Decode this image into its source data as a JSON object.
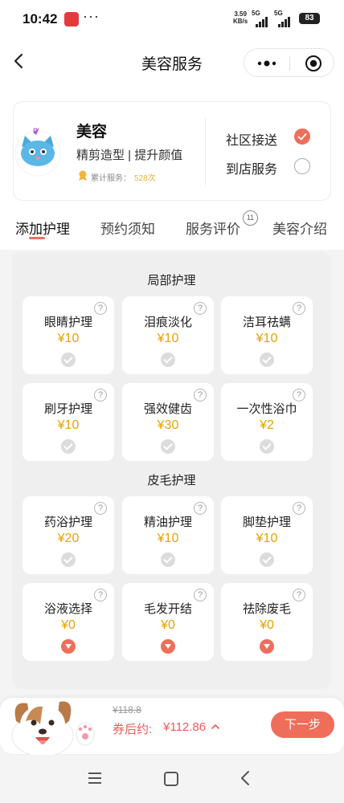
{
  "status_bar": {
    "time": "10:42",
    "dots": "···",
    "net_speed_value": "3.59",
    "net_speed_unit": "KB/s",
    "network_1": "5G",
    "network_2": "5G",
    "battery": "83"
  },
  "nav": {
    "title": "美容服务"
  },
  "service": {
    "name": "美容",
    "description": "精剪造型 | 提升颜值",
    "count_label": "累计服务：",
    "count_value": "528次",
    "options": [
      {
        "label": "社区接送",
        "selected": true
      },
      {
        "label": "到店服务",
        "selected": false
      }
    ]
  },
  "tabs": [
    {
      "label": "添加护理",
      "active": true
    },
    {
      "label": "预约须知",
      "active": false
    },
    {
      "label": "服务评价",
      "active": false,
      "badge": "11"
    },
    {
      "label": "美容介绍",
      "active": false
    }
  ],
  "sections": [
    {
      "title": "局部护理",
      "items": [
        {
          "name": "眼睛护理",
          "price": "¥10",
          "state": "check"
        },
        {
          "name": "泪痕淡化",
          "price": "¥10",
          "state": "check"
        },
        {
          "name": "洁耳祛螨",
          "price": "¥10",
          "state": "check"
        },
        {
          "name": "刷牙护理",
          "price": "¥10",
          "state": "check"
        },
        {
          "name": "强效健齿",
          "price": "¥30",
          "state": "check"
        },
        {
          "name": "一次性浴巾",
          "price": "¥2",
          "state": "check"
        }
      ]
    },
    {
      "title": "皮毛护理",
      "items": [
        {
          "name": "药浴护理",
          "price": "¥20",
          "state": "check"
        },
        {
          "name": "精油护理",
          "price": "¥10",
          "state": "check"
        },
        {
          "name": "脚垫护理",
          "price": "¥10",
          "state": "check"
        },
        {
          "name": "浴液选择",
          "price": "¥0",
          "state": "expand"
        },
        {
          "name": "毛发开结",
          "price": "¥0",
          "state": "expand"
        },
        {
          "name": "祛除废毛",
          "price": "¥0",
          "state": "expand"
        }
      ]
    }
  ],
  "bottom": {
    "original_price": "¥118.8",
    "coupon_label": "券后约:",
    "final_price": "¥112.86",
    "next_label": "下一步"
  },
  "colors": {
    "accent": "#ef6e5a",
    "price": "#e5a400",
    "count": "#e9b33c",
    "final_price": "#ef5a5a"
  },
  "icons": {
    "question": "?"
  }
}
